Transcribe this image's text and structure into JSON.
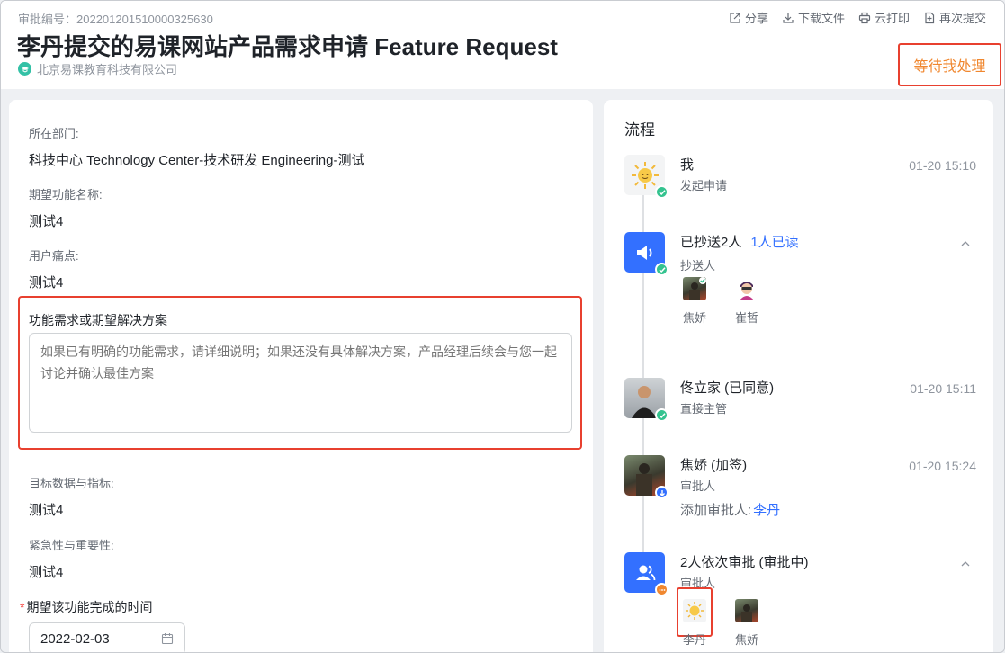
{
  "header": {
    "approval_no": "审批编号：202201201510000325630",
    "title": "李丹提交的易课网站产品需求申请 Feature Request",
    "company": "北京易课教育科技有限公司",
    "actions": [
      {
        "label": "分享",
        "icon": "share-icon"
      },
      {
        "label": "下载文件",
        "icon": "download-icon"
      },
      {
        "label": "云打印",
        "icon": "print-icon"
      },
      {
        "label": "再次提交",
        "icon": "resubmit-icon"
      }
    ],
    "status": "等待我处理"
  },
  "form": {
    "department": {
      "label": "所在部门:",
      "value": "科技中心 Technology Center-技术研发 Engineering-测试"
    },
    "feature_name": {
      "label": "期望功能名称:",
      "value": "测试4"
    },
    "pain_point": {
      "label": "用户痛点:",
      "value": "测试4"
    },
    "solution": {
      "label": "功能需求或期望解决方案",
      "placeholder": "如果已有明确的功能需求，请详细说明；如果还没有具体解决方案，产品经理后续会与您一起讨论并确认最佳方案"
    },
    "target_data": {
      "label": "目标数据与指标:",
      "value": "测试4"
    },
    "urgency": {
      "label": "紧急性与重要性:",
      "value": "测试4"
    },
    "due_date": {
      "required": "*",
      "label": "期望该功能完成的时间",
      "value": "2022-02-03"
    }
  },
  "flow": {
    "title": "流程",
    "steps": [
      {
        "name": "我",
        "sub": "发起申请",
        "time": "01-20 15:10"
      },
      {
        "name": "已抄送2人",
        "read": "1人已读",
        "sub": "抄送人",
        "people": [
          {
            "name": "焦娇"
          },
          {
            "name": "崔哲"
          }
        ]
      },
      {
        "name": "佟立家 (已同意)",
        "sub": "直接主管",
        "time": "01-20 15:11"
      },
      {
        "name": "焦娇 (加签)",
        "sub": "审批人",
        "time": "01-20 15:24",
        "add_label": "添加审批人:",
        "add_name": "李丹"
      },
      {
        "name": "2人依次审批 (审批中)",
        "sub": "审批人",
        "people": [
          {
            "name": "李丹"
          },
          {
            "name": "焦娇"
          }
        ]
      }
    ]
  },
  "colors": {
    "accent_blue": "#3370ff",
    "success_green": "#34c38f",
    "status_orange": "#f0872f",
    "highlight_red": "#e8402f"
  }
}
